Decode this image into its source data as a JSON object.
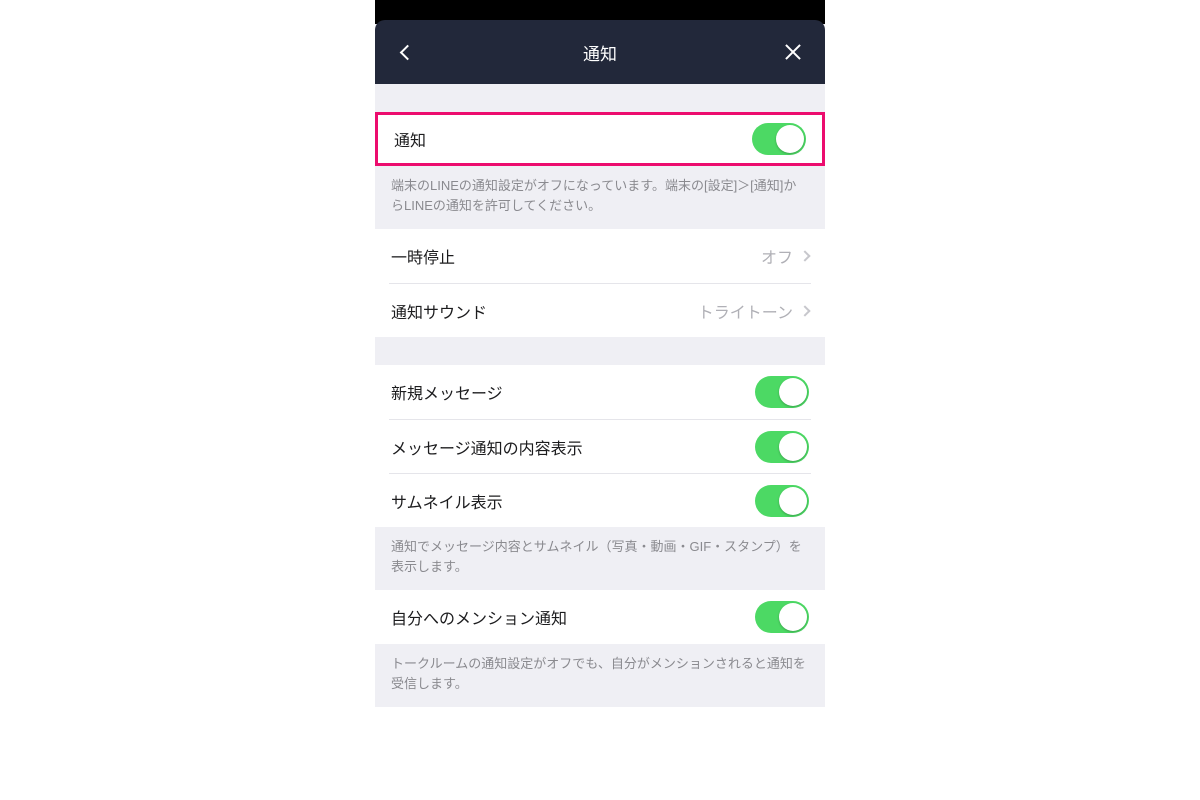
{
  "header": {
    "title": "通知"
  },
  "main_toggle": {
    "label": "通知",
    "on": true
  },
  "main_footer": "端末のLINEの通知設定がオフになっています。端末の[設定]＞[通知]からLINEの通知を許可してください。",
  "rows": {
    "pause": {
      "label": "一時停止",
      "value": "オフ"
    },
    "sound": {
      "label": "通知サウンド",
      "value": "トライトーン"
    }
  },
  "msg": {
    "new": {
      "label": "新規メッセージ",
      "on": true
    },
    "preview": {
      "label": "メッセージ通知の内容表示",
      "on": true
    },
    "thumb": {
      "label": "サムネイル表示",
      "on": true
    },
    "footer": "通知でメッセージ内容とサムネイル（写真・動画・GIF・スタンプ）を表示します。"
  },
  "mention": {
    "label": "自分へのメンション通知",
    "on": true,
    "footer": "トークルームの通知設定がオフでも、自分がメンションされると通知を受信します。"
  }
}
